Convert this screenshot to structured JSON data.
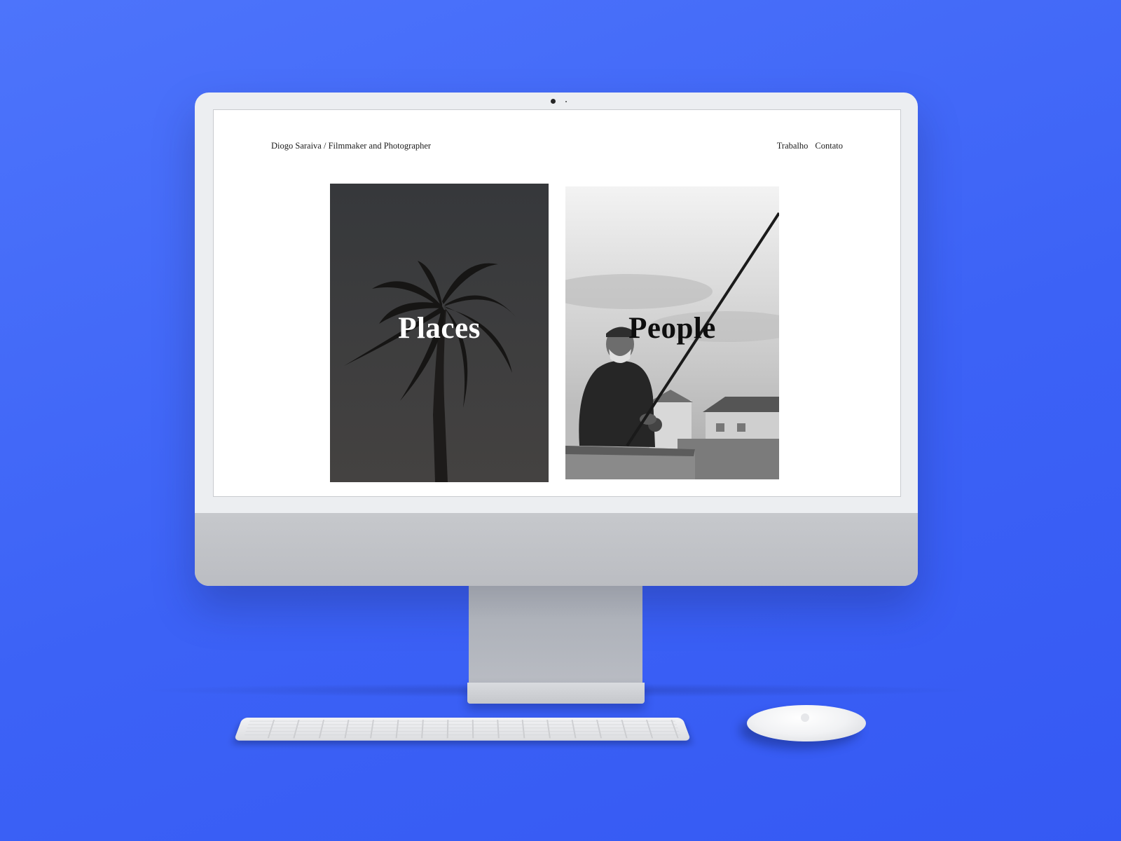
{
  "site": {
    "title": "Diogo Saraiva / Filmmaker and Photographer",
    "nav": [
      {
        "label": "Trabalho"
      },
      {
        "label": "Contato"
      }
    ]
  },
  "cards": [
    {
      "label": "Places",
      "image": "palm-tree-photo"
    },
    {
      "label": "People",
      "image": "fisherman-photo"
    }
  ],
  "colors": {
    "background": "#4468f7",
    "screen": "#ffffff",
    "places_card": "#3a3b3e"
  }
}
